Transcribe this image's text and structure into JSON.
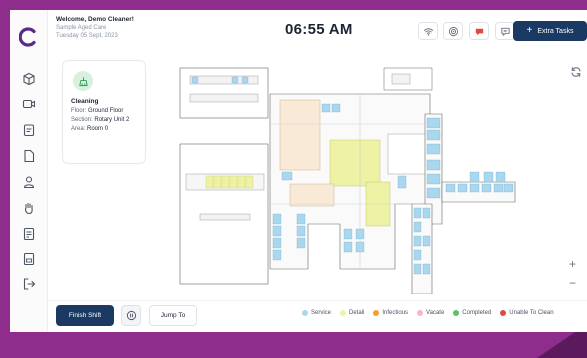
{
  "header": {
    "welcome": "Welcome, Demo Cleaner!",
    "organization": "Sample Aged Care",
    "date": "Tuesday 05 Sept, 2023",
    "clock": "06:55 AM",
    "extra_tasks_label": "Extra Tasks"
  },
  "sidebar": {
    "items": [
      {
        "icon": "box-icon"
      },
      {
        "icon": "video-icon"
      },
      {
        "icon": "clipboard-icon"
      },
      {
        "icon": "file-icon"
      },
      {
        "icon": "person-icon"
      },
      {
        "icon": "hand-icon"
      },
      {
        "icon": "report-icon"
      },
      {
        "icon": "document-icon"
      },
      {
        "icon": "logout-icon"
      }
    ]
  },
  "task_card": {
    "title": "Cleaning",
    "floor_label": "Floor:",
    "floor": "Ground Floor",
    "section_label": "Section:",
    "section": "Rotary Unit 2",
    "area_label": "Area:",
    "area": "Room 0"
  },
  "footer": {
    "finish_shift_label": "Finish Shift",
    "jump_to_label": "Jump To"
  },
  "legend": [
    {
      "label": "Service",
      "color": "#a9d8ee"
    },
    {
      "label": "Detail",
      "color": "#eef2a4"
    },
    {
      "label": "Infectious",
      "color": "#f59f2a"
    },
    {
      "label": "Vacate",
      "color": "#f6b5c9"
    },
    {
      "label": "Completed",
      "color": "#5cc06b"
    },
    {
      "label": "Unable To Clean",
      "color": "#e04848"
    }
  ],
  "colors": {
    "primary": "#1a3a63",
    "frame": "#8e2d8c",
    "logo": "#5b2a86",
    "notification": "#e24545"
  }
}
